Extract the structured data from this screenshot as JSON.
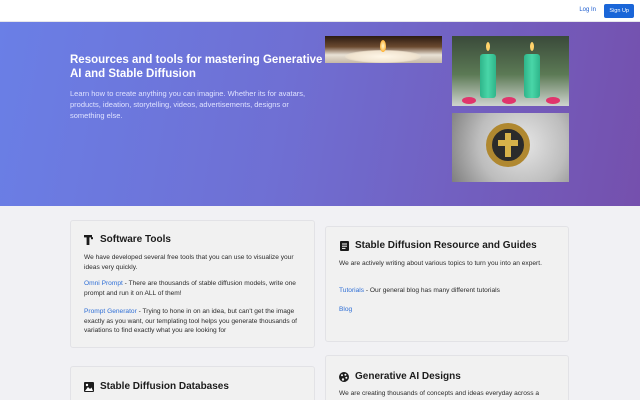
{
  "nav": {
    "login": "Log In",
    "signup": "Sign Up"
  },
  "hero": {
    "title": "Resources and tools for mastering Generative AI and Stable Diffusion",
    "subtitle": "Learn how to create anything you can imagine. Whether its for avatars, products, ideation, storytelling, videos, advertisements, designs or something else."
  },
  "images": {
    "icons": [
      "candle-image",
      "vases-image",
      "ring-image"
    ]
  },
  "cards": {
    "software": {
      "title": "Software Tools",
      "icon": "text-tool-icon",
      "intro": "We have developed several free tools that you can use to visualize your ideas very quickly.",
      "omni_link": "Omni Prompt",
      "omni_text": " - There are thousands of stable diffusion models, write one prompt and run it on ALL of them!",
      "gen_link": "Prompt Generator",
      "gen_text": " - Trying to hone in on an idea, but can't get the image exactly as you want, our templating tool helps you generate thousands of variations to find exactly what you are looking for"
    },
    "guides": {
      "title": "Stable Diffusion Resource and Guides",
      "icon": "document-icon",
      "intro": "We are actively writing about various topics to turn you into an expert.",
      "tutorials_link": "Tutorials",
      "tutorials_text": " - Our general blog has many different tutorials",
      "blog_link": "Blog"
    },
    "databases": {
      "title": "Stable Diffusion Databases",
      "icon": "image-database-icon"
    },
    "designs": {
      "title": "Generative AI Designs",
      "icon": "palette-icon",
      "intro": "We are creating thousands of concepts and ideas everyday across a"
    }
  }
}
